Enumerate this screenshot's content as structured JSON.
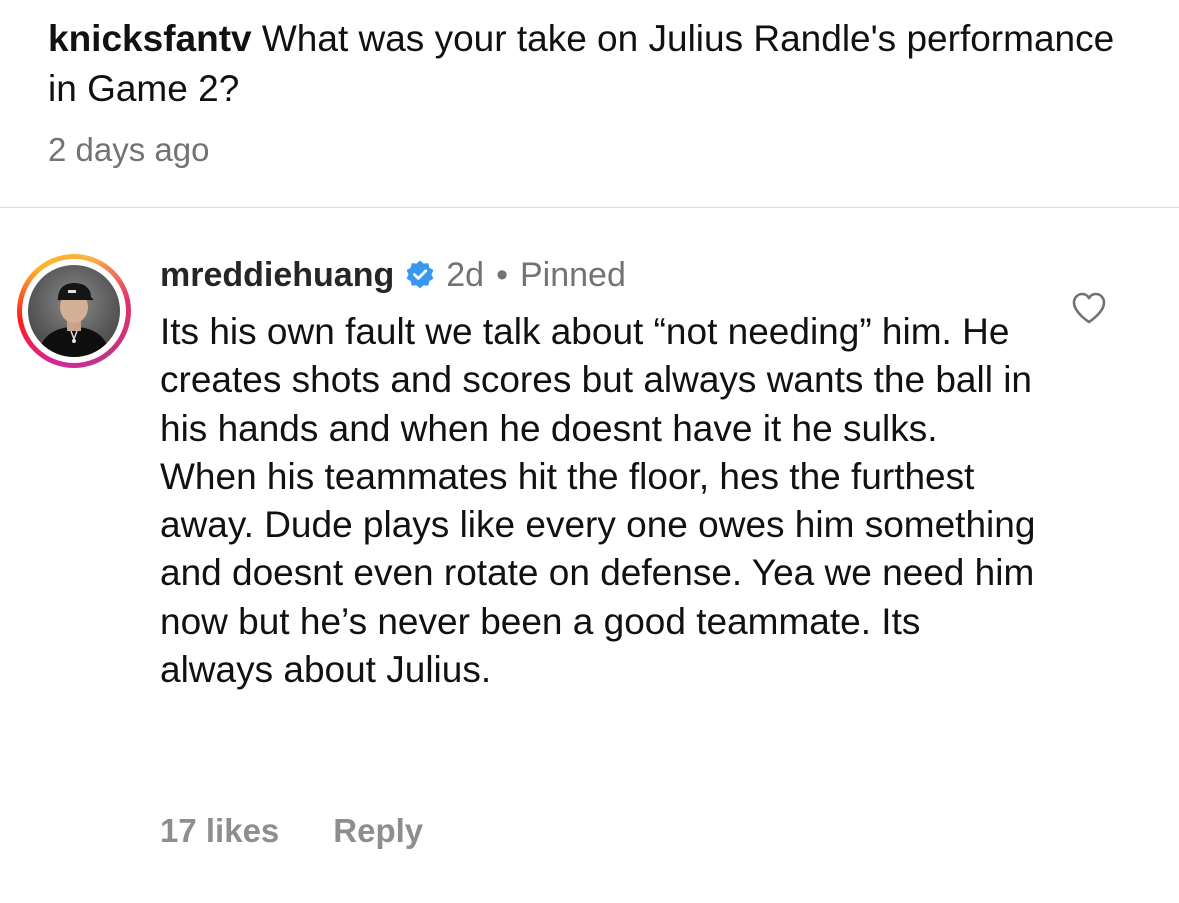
{
  "question": {
    "username": "knicksfantv",
    "text": "What was your take on Julius Randle's performance in Game 2?",
    "timestamp": "2 days ago"
  },
  "comment": {
    "username": "mreddiehuang",
    "verified_icon": "verified-badge-icon",
    "timestamp": "2d",
    "separator": "•",
    "pinned_label": "Pinned",
    "body": "Its his own fault we talk about “not needing” him. He creates shots and scores but always wants the ball in his hands and when he doesnt have it he sulks. When his teammates hit the floor, hes the furthest away. Dude plays like every one owes him something and doesnt even rotate on defense. Yea we need him now but he’s never been a good teammate. Its always about Julius.",
    "likes": "17 likes",
    "reply_label": "Reply",
    "like_icon": "heart-icon"
  },
  "colors": {
    "text": "#111111",
    "secondary": "#737373",
    "footer": "#8e8e8e",
    "verified": "#3897f0",
    "divider": "#dcdcdc"
  }
}
